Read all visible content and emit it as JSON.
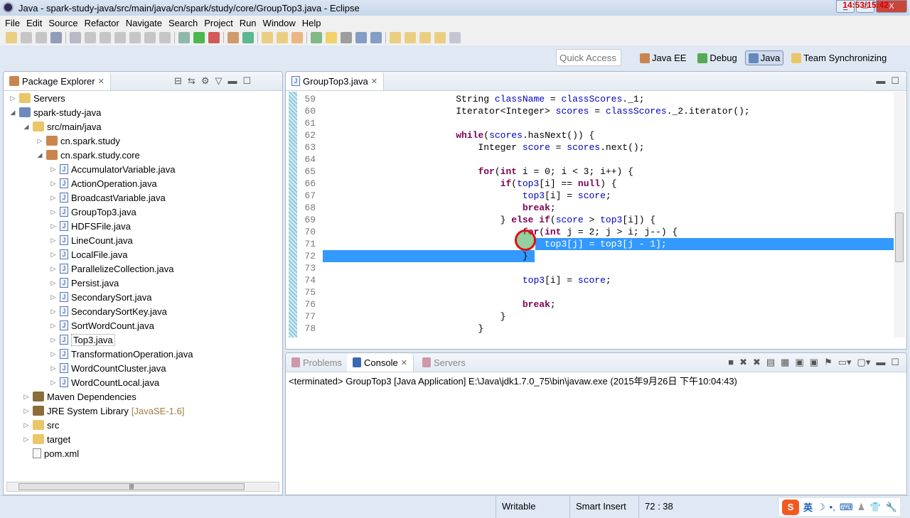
{
  "window": {
    "title": "Java - spark-study-java/src/main/java/cn/spark/study/core/GroupTop3.java - Eclipse",
    "clock": "14:53/15:42"
  },
  "menu": [
    "File",
    "Edit",
    "Source",
    "Refactor",
    "Navigate",
    "Search",
    "Project",
    "Run",
    "Window",
    "Help"
  ],
  "quick_access": {
    "placeholder": "Quick Access"
  },
  "perspectives": [
    {
      "label": "Java EE",
      "active": false
    },
    {
      "label": "Debug",
      "active": false
    },
    {
      "label": "Java",
      "active": true
    },
    {
      "label": "Team Synchronizing",
      "active": false
    }
  ],
  "package_explorer": {
    "title": "Package Explorer",
    "items": [
      {
        "label": "Servers",
        "level": 0,
        "icon": "folder",
        "expanded": false
      },
      {
        "label": "spark-study-java",
        "level": 0,
        "icon": "project",
        "expanded": true
      },
      {
        "label": "src/main/java",
        "level": 1,
        "icon": "folder",
        "expanded": true
      },
      {
        "label": "cn.spark.study",
        "level": 2,
        "icon": "package",
        "expanded": false
      },
      {
        "label": "cn.spark.study.core",
        "level": 2,
        "icon": "package",
        "expanded": true
      },
      {
        "label": "AccumulatorVariable.java",
        "level": 3,
        "icon": "java"
      },
      {
        "label": "ActionOperation.java",
        "level": 3,
        "icon": "java"
      },
      {
        "label": "BroadcastVariable.java",
        "level": 3,
        "icon": "java"
      },
      {
        "label": "GroupTop3.java",
        "level": 3,
        "icon": "java"
      },
      {
        "label": "HDFSFile.java",
        "level": 3,
        "icon": "java"
      },
      {
        "label": "LineCount.java",
        "level": 3,
        "icon": "java"
      },
      {
        "label": "LocalFile.java",
        "level": 3,
        "icon": "java"
      },
      {
        "label": "ParallelizeCollection.java",
        "level": 3,
        "icon": "java"
      },
      {
        "label": "Persist.java",
        "level": 3,
        "icon": "java"
      },
      {
        "label": "SecondarySort.java",
        "level": 3,
        "icon": "java"
      },
      {
        "label": "SecondarySortKey.java",
        "level": 3,
        "icon": "java"
      },
      {
        "label": "SortWordCount.java",
        "level": 3,
        "icon": "java"
      },
      {
        "label": "Top3.java",
        "level": 3,
        "icon": "java",
        "selected": true
      },
      {
        "label": "TransformationOperation.java",
        "level": 3,
        "icon": "java"
      },
      {
        "label": "WordCountCluster.java",
        "level": 3,
        "icon": "java"
      },
      {
        "label": "WordCountLocal.java",
        "level": 3,
        "icon": "java"
      },
      {
        "label": "Maven Dependencies",
        "level": 1,
        "icon": "library",
        "expanded": false
      },
      {
        "label": "JRE System Library",
        "suffix": "[JavaSE-1.6]",
        "level": 1,
        "icon": "library",
        "expanded": false
      },
      {
        "label": "src",
        "level": 1,
        "icon": "folder",
        "expanded": false
      },
      {
        "label": "target",
        "level": 1,
        "icon": "folder",
        "expanded": false
      },
      {
        "label": "pom.xml",
        "level": 1,
        "icon": "xml"
      }
    ]
  },
  "editor": {
    "tab": "GroupTop3.java",
    "lines": [
      {
        "n": "59",
        "text": "                        String className = classScores._1;"
      },
      {
        "n": "60",
        "text": "                        Iterator<Integer> scores = classScores._2.iterator();"
      },
      {
        "n": "61",
        "text": ""
      },
      {
        "n": "62",
        "text": "                        while(scores.hasNext()) {"
      },
      {
        "n": "63",
        "text": "                            Integer score = scores.next();"
      },
      {
        "n": "64",
        "text": ""
      },
      {
        "n": "65",
        "text": "                            for(int i = 0; i < 3; i++) {"
      },
      {
        "n": "66",
        "text": "                                if(top3[i] == null) {"
      },
      {
        "n": "67",
        "text": "                                    top3[i] = score;"
      },
      {
        "n": "68",
        "text": "                                    break;"
      },
      {
        "n": "69",
        "text": "                                } else if(score > top3[i]) {"
      },
      {
        "n": "70",
        "text": "                                    for(int j = 2; j > i; j--) {"
      },
      {
        "n": "71",
        "text": "                                        top3[j] = top3[j - 1];"
      },
      {
        "n": "72",
        "text": "                                    }"
      },
      {
        "n": "73",
        "text": ""
      },
      {
        "n": "74",
        "text": "                                    top3[i] = score;"
      },
      {
        "n": "75",
        "text": ""
      },
      {
        "n": "76",
        "text": "                                    break;"
      },
      {
        "n": "77",
        "text": "                                }"
      },
      {
        "n": "78",
        "text": "                            }"
      }
    ]
  },
  "console": {
    "tabs": [
      {
        "label": "Problems",
        "active": false
      },
      {
        "label": "Console",
        "active": true
      },
      {
        "label": "Servers",
        "active": false
      }
    ],
    "header": "<terminated> GroupTop3 [Java Application] E:\\Java\\jdk1.7.0_75\\bin\\javaw.exe (2015年9月26日 下午10:04:43)"
  },
  "status": {
    "writable": "Writable",
    "insert_mode": "Smart Insert",
    "position": "72 : 38",
    "ime_lang": "英"
  },
  "colors": {
    "keyword": "#7f0055",
    "field": "#0000c0",
    "selection": "#3399ff"
  }
}
